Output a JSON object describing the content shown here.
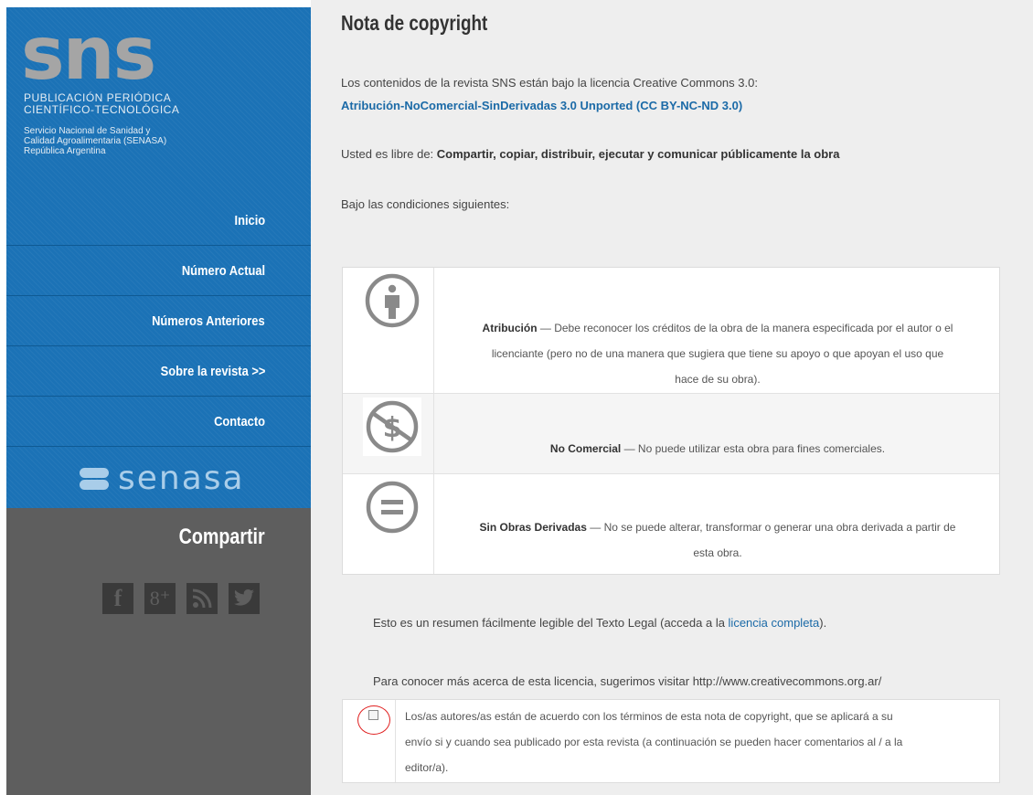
{
  "sidebar": {
    "logo": "sns",
    "pub_line1": "PUBLICACIÓN   PERIÓDICA",
    "pub_line2": "CIENTÍFICO-TECNOLÓGICA",
    "org_line1": "Servicio Nacional de Sanidad y",
    "org_line2": "Calidad Agroalimentaria (SENASA)",
    "org_line3": "República Argentina",
    "nav": [
      {
        "label": "Inicio"
      },
      {
        "label": "Número Actual"
      },
      {
        "label": "Números Anteriores"
      },
      {
        "label": "Sobre la revista >>"
      },
      {
        "label": "Contacto"
      }
    ],
    "senasa_logo": "senasa",
    "share_title": "Compartir",
    "social": [
      {
        "glyph": "f",
        "icon": "facebook-icon"
      },
      {
        "glyph": "8⁺",
        "icon": "google-plus-icon"
      },
      {
        "glyph": "rss",
        "icon": "rss-icon"
      },
      {
        "glyph": "twitter",
        "icon": "twitter-icon"
      }
    ]
  },
  "main": {
    "title": "Nota de copyright",
    "intro": "Los contenidos de la revista SNS están bajo la licencia Creative Commons 3.0:",
    "license_link": "Atribución-NoComercial-SinDerivadas 3.0 Unported (CC BY-NC-ND 3.0)",
    "free_prefix": "Usted es libre de: ",
    "free_bold": "Compartir, copiar, distribuir, ejecutar y comunicar públicamente la obra",
    "conditions": "Bajo las condiciones siguientes:",
    "licenses": [
      {
        "icon": "attribution-icon",
        "name": "Atribución",
        "text1": " — Debe reconocer los créditos de la obra de la manera especificada por el autor o el",
        "text2": "licenciante (pero no de una manera que sugiera que tiene su apoyo o que apoyan el uso que",
        "text3": "hace de su obra)."
      },
      {
        "icon": "non-commercial-icon",
        "name": "No Comercial",
        "text1": " — No puede utilizar esta obra para fines comerciales."
      },
      {
        "icon": "no-derivatives-icon",
        "name": "Sin Obras Derivadas",
        "text1": " — No se puede alterar, transformar o generar una obra derivada a partir de",
        "text2": "esta obra."
      }
    ],
    "summary_prefix": "Esto es un resumen fácilmente legible del Texto Legal (acceda a la ",
    "summary_link": "licencia completa",
    "summary_suffix": ").",
    "more_info": "Para conocer más acerca de esta licencia, sugerimos visitar http://www.creativecommons.org.ar/",
    "agreement_line1": "Los/as autores/as están de acuerdo con los términos de esta nota de copyright, que se aplicará a su",
    "agreement_line2": "envío si y cuando sea publicado por esta revista (a continuación se pueden hacer comentarios al / a la",
    "agreement_line3": "editor/a)."
  },
  "colors": {
    "sidebar_blue": "#1b72b6",
    "sidebar_gray": "#5e5e5e",
    "link_blue": "#1b6aa7",
    "highlight_red": "#e02020"
  }
}
